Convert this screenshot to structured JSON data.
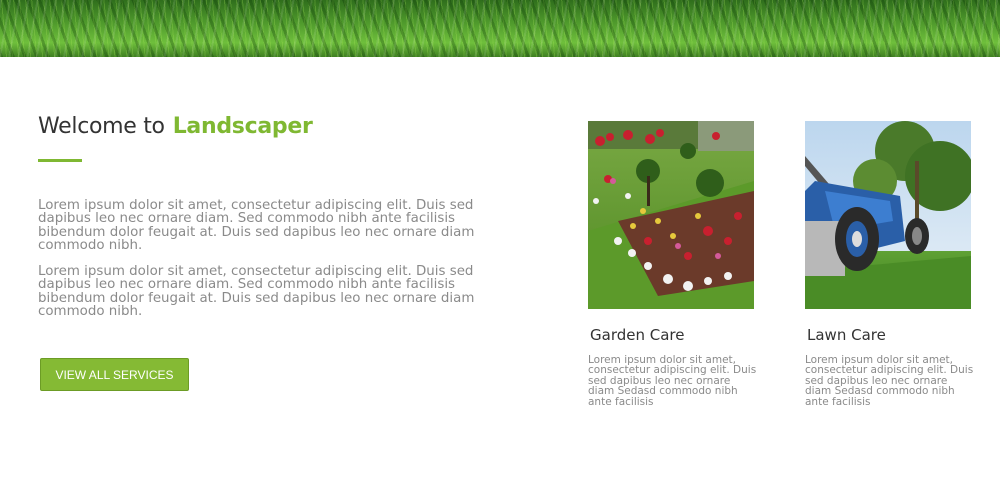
{
  "banner": {
    "image": "grass-banner-image"
  },
  "welcome": {
    "prefix": "Welcome to",
    "brand": "Landscaper",
    "brand_color": "#7fb832"
  },
  "paragraphs": [
    "Lorem ipsum dolor sit amet, consectetur adipiscing elit. Duis sed dapibus leo nec ornare diam. Sed commodo nibh ante facilisis bibendum dolor feugait at. Duis sed dapibus leo nec ornare diam commodo nibh.",
    "Lorem ipsum dolor sit amet, consectetur adipiscing elit. Duis sed dapibus leo nec ornare diam. Sed commodo nibh ante facilisis bibendum dolor feugait at. Duis sed dapibus leo nec ornare diam commodo nibh."
  ],
  "cta": {
    "label": "VIEW ALL SERVICES",
    "color": "#85ba34"
  },
  "services": [
    {
      "title": "Garden Care",
      "image": "flower-garden-image",
      "text": "Lorem ipsum dolor sit amet, consectetur adipiscing elit. Duis sed dapibus leo nec ornare diam Sedasd commodo nibh ante facilisis"
    },
    {
      "title": "Lawn Care",
      "image": "lawn-mower-image",
      "text": "Lorem ipsum dolor sit amet, consectetur adipiscing elit. Duis sed dapibus leo nec ornare diam Sedasd commodo nibh ante facilisis"
    }
  ]
}
